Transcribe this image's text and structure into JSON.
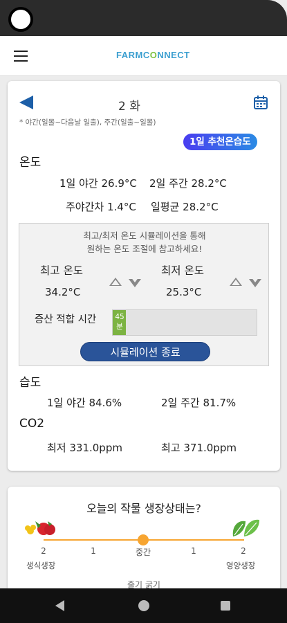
{
  "header": {
    "logo_part1": "FARMC",
    "logo_accent": "O",
    "logo_part2": "NNECT",
    "menu_icon": "hamburger-menu-icon"
  },
  "schedule": {
    "title": "2 화",
    "note": "* 야간(일몰~다음날 일출), 주간(일출~일몰)",
    "badge": "1일 추천온습도",
    "back_icon": "back-arrow-icon",
    "calendar_icon": "calendar-icon"
  },
  "temperature": {
    "label": "온도",
    "night": "1일 야간 26.9°C",
    "day": "2일 주간 28.2°C",
    "diff": "주야간차 1.4°C",
    "avg": "일평균 28.2°C"
  },
  "simulation": {
    "message_line1": "최고/최저 온도 시뮬레이션을 통해",
    "message_line2": "원하는 온도 조절에 참고하세요!",
    "max_label": "최고 온도",
    "max_value": "34.2°C",
    "min_label": "최저 온도",
    "min_value": "25.3°C",
    "fit_label": "증산 적합 시간",
    "fit_value": "45분",
    "fit_fraction": 0.09,
    "end_button": "시뮬레이션 종료"
  },
  "humidity": {
    "label": "습도",
    "night": "1일 야간 84.6%",
    "day": "2일 주간 81.7%"
  },
  "co2": {
    "label": "CO2",
    "min": "최저 331.0ppm",
    "max": "최고 371.0ppm"
  },
  "growth": {
    "title": "오늘의 작물 생장상태는?",
    "ticks": [
      "2",
      "1",
      "중간",
      "1",
      "2"
    ],
    "left_label": "생식생장",
    "right_label": "영양생장",
    "partial_text": "줄기 굵기"
  },
  "colors": {
    "accent_blue": "#1d5fa8",
    "badge_gradient_start": "#4a3df0",
    "badge_gradient_end": "#2b8be4",
    "button_blue": "#2a5499",
    "progress_green": "#7cb342",
    "scale_orange": "#f7a531"
  }
}
